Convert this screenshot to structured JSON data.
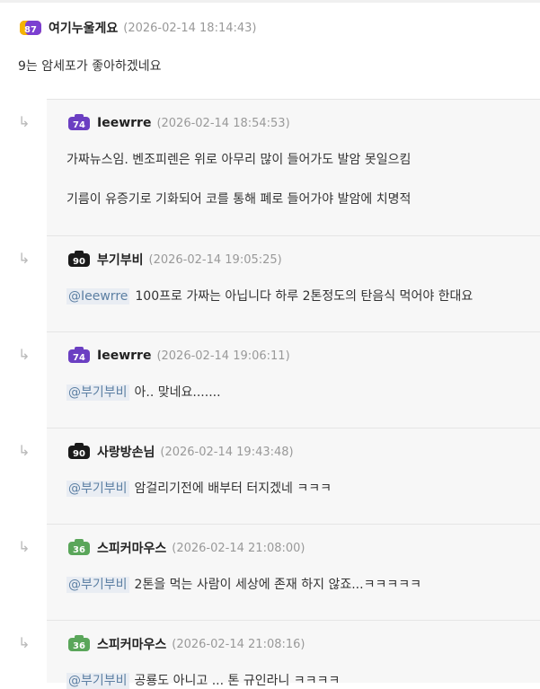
{
  "main": {
    "level": "87",
    "nick": "여기누울게요",
    "time": "(2026-02-14 18:14:43)",
    "text": "9는 암세포가 좋아하겠네요"
  },
  "replies": [
    {
      "level": "74",
      "nick": "Ieewrre",
      "time": "(2026-02-14 18:54:53)",
      "mention": "",
      "line1": "가짜뉴스임. 벤조피렌은 위로 아무리 많이 들어가도 발암 못일으킴",
      "line2": "기름이 유증기로 기화되어 코를 통해 폐로 들어가야 발암에 치명적",
      "badge_color": "#6b3fc2"
    },
    {
      "level": "90",
      "nick": "부기부비",
      "time": "(2026-02-14 19:05:25)",
      "mention": "@Ieewrre",
      "line1": "100프로 가짜는 아닙니다 하루 2톤정도의 탄음식 먹어야 한대요",
      "badge_color": "#1a1a1a"
    },
    {
      "level": "74",
      "nick": "Ieewrre",
      "time": "(2026-02-14 19:06:11)",
      "mention": "@부기부비",
      "line1": "아.. 맞네요.......",
      "badge_color": "#6b3fc2"
    },
    {
      "level": "90",
      "nick": "사랑방손님",
      "time": "(2026-02-14 19:43:48)",
      "mention": "@부기부비",
      "line1": "암걸리기전에 배부터 터지겠네 ㅋㅋㅋ",
      "badge_color": "#1a1a1a"
    },
    {
      "level": "36",
      "nick": "스피커마우스",
      "time": "(2026-02-14 21:08:00)",
      "mention": "@부기부비",
      "line1": "2톤을 먹는 사람이 세상에 존재 하지 않죠...ㅋㅋㅋㅋㅋ",
      "badge_color": "#5aa65a"
    },
    {
      "level": "36",
      "nick": "스피커마우스",
      "time": "(2026-02-14 21:08:16)",
      "mention": "@부기부비",
      "line1": "공룡도 아니고 ... 톤 규인라니 ㅋㅋㅋㅋ",
      "badge_color": "#5aa65a"
    }
  ],
  "reply_arrow": "↳"
}
